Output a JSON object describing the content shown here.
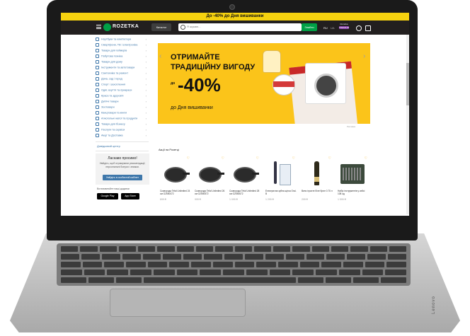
{
  "promo_bar": {
    "text": "До -40% до Дня вишиванки"
  },
  "header": {
    "logo": "ROZETKA",
    "catalog": "Каталог",
    "search_placeholder": "Я шукаю...",
    "search_button": "Знайти",
    "lang_active": "RU",
    "lang_other": "UA",
    "premium_top": "Rozetka",
    "premium_badge": "PREMIUM"
  },
  "sidebar": {
    "categories": [
      "Ноутбуки та комп'ютери",
      "Смартфони, ТВ і електроніка",
      "Товари для геймерів",
      "Побутова техніка",
      "Товари для дому",
      "Інструменти та автотовари",
      "Сантехніка та ремонт",
      "Дача, сад і город",
      "Спорт і захоплення",
      "Одяг, взуття та прикраси",
      "Краса та здоров'я",
      "Дитячі товари",
      "Зоотовари",
      "Канцтовари та книги",
      "Алкогольні напої та продукти",
      "Товари для бізнесу",
      "Послуги та сервіси",
      "Акції та Доставка"
    ],
    "help_link": "Довідковий центр",
    "welcome_title": "Ласкаво просимо!",
    "welcome_text": "Увійдіть, щоб отримувати рекомендації, персональні бонуси і знижки.",
    "welcome_button": "Увійдіть в особистий кабінет",
    "apps_title": "Встановлюйте наші додатки",
    "google_play": "Google Play",
    "app_store": "App Store"
  },
  "banner": {
    "line1": "ОТРИМАЙТЕ",
    "line2": "ТРАДИЦІЙНУ ВИГОДУ",
    "do": "до",
    "percent": "-40%",
    "line3": "до Дня вишиванки",
    "note": "Реклама"
  },
  "section": {
    "title": "Акції на Розетці"
  },
  "products": [
    {
      "title": "Сковорода Tefal Unlimited 24 см G2550472",
      "price": "899 ₴"
    },
    {
      "title": "Сковорода Tefal Unlimited 26 см G2550572",
      "price": "999 ₴"
    },
    {
      "title": "Сковорода Tefal Unlimited 28 см G2550672",
      "price": "1 099 ₴"
    },
    {
      "title": "Електрична зубна щітка Oral-B",
      "price": "1 299 ₴"
    },
    {
      "title": "Вино ігристе біле брют 0.75 л",
      "price": "299 ₴"
    },
    {
      "title": "Набір інструментів у кейсі 108 од",
      "price": "1 599 ₴"
    }
  ]
}
